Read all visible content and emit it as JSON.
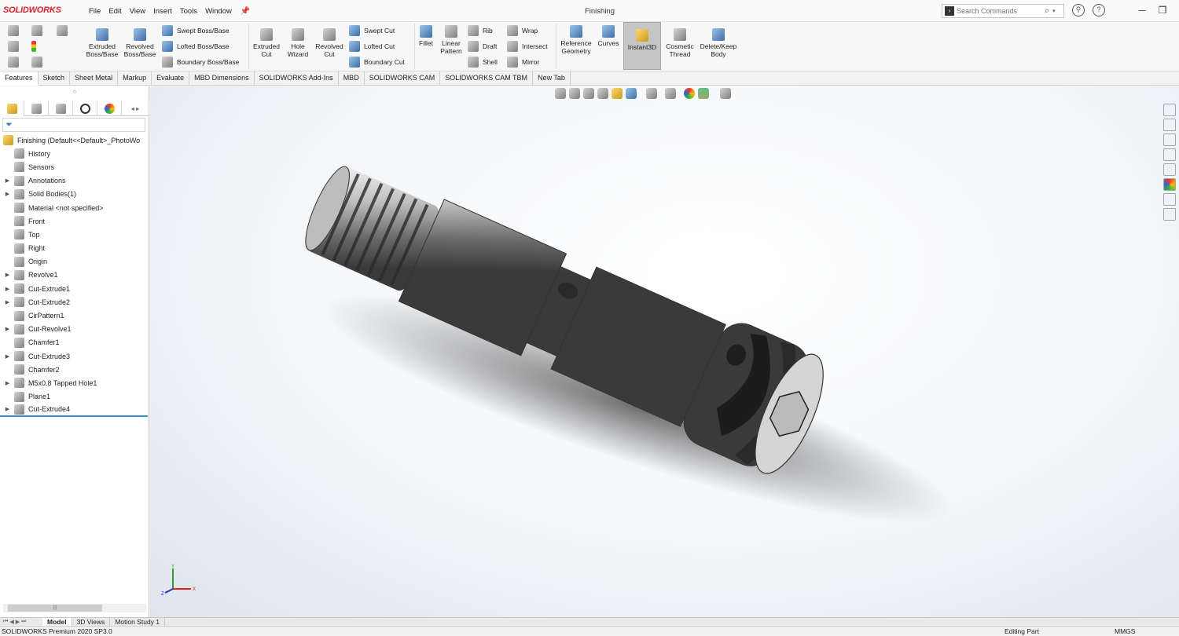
{
  "app": {
    "logo_text": "SOLIDWORKS",
    "document_title": "Finishing",
    "brand_color": "#d2232a"
  },
  "menu": [
    "File",
    "Edit",
    "View",
    "Insert",
    "Tools",
    "Window"
  ],
  "search": {
    "placeholder": "Search Commands"
  },
  "ribbon": {
    "extruded_boss": "Extruded Boss/Base",
    "revolved_boss": "Revolved Boss/Base",
    "swept_boss": "Swept Boss/Base",
    "lofted_boss": "Lofted Boss/Base",
    "boundary_boss": "Boundary Boss/Base",
    "extruded_cut": "Extruded Cut",
    "hole_wizard": "Hole Wizard",
    "revolved_cut": "Revolved Cut",
    "swept_cut": "Swept Cut",
    "lofted_cut": "Lofted Cut",
    "boundary_cut": "Boundary Cut",
    "fillet": "Fillet",
    "linear_pattern": "Linear Pattern",
    "rib": "Rib",
    "draft": "Draft",
    "shell": "Shell",
    "wrap": "Wrap",
    "intersect": "Intersect",
    "mirror": "Mirror",
    "reference_geometry": "Reference Geometry",
    "curves": "Curves",
    "instant3d": "Instant3D",
    "cosmetic_thread": "Cosmetic Thread",
    "delete_keep_body": "Delete/Keep Body"
  },
  "command_tabs": [
    "Features",
    "Sketch",
    "Sheet Metal",
    "Markup",
    "Evaluate",
    "MBD Dimensions",
    "SOLIDWORKS Add-Ins",
    "MBD",
    "SOLIDWORKS CAM",
    "SOLIDWORKS CAM TBM",
    "New Tab"
  ],
  "tree": {
    "root": "Finishing  (Default<<Default>_PhotoWo",
    "items": [
      {
        "label": "History",
        "exp": ""
      },
      {
        "label": "Sensors",
        "exp": ""
      },
      {
        "label": "Annotations",
        "exp": "▶"
      },
      {
        "label": "Solid Bodies(1)",
        "exp": "▶"
      },
      {
        "label": "Material <not specified>",
        "exp": ""
      },
      {
        "label": "Front",
        "exp": ""
      },
      {
        "label": "Top",
        "exp": ""
      },
      {
        "label": "Right",
        "exp": ""
      },
      {
        "label": "Origin",
        "exp": ""
      },
      {
        "label": "Revolve1",
        "exp": "▶"
      },
      {
        "label": "Cut-Extrude1",
        "exp": "▶"
      },
      {
        "label": "Cut-Extrude2",
        "exp": "▶"
      },
      {
        "label": "CirPattern1",
        "exp": ""
      },
      {
        "label": "Cut-Revolve1",
        "exp": "▶"
      },
      {
        "label": "Chamfer1",
        "exp": ""
      },
      {
        "label": "Cut-Extrude3",
        "exp": "▶"
      },
      {
        "label": "Chamfer2",
        "exp": ""
      },
      {
        "label": "M5x0.8 Tapped Hole1",
        "exp": "▶"
      },
      {
        "label": "Plane1",
        "exp": ""
      },
      {
        "label": "Cut-Extrude4",
        "exp": "▶"
      }
    ]
  },
  "bottom_tabs": [
    "Model",
    "3D Views",
    "Motion Study 1"
  ],
  "status": {
    "left": "SOLIDWORKS Premium 2020 SP3.0",
    "editing": "Editing Part",
    "units": "MMGS"
  },
  "triad": {
    "x": "X",
    "y": "Y",
    "z": "Z"
  }
}
